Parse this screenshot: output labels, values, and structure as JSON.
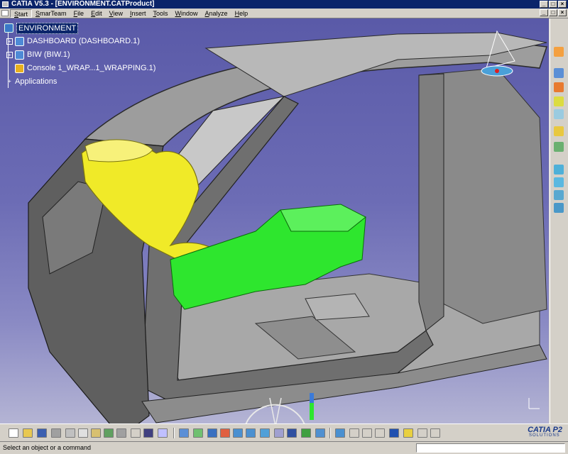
{
  "window": {
    "title": "CATIA V5.3 - [ENVIRONMENT.CATProduct]",
    "min_glyph": "_",
    "max_glyph": "□",
    "close_glyph": "×"
  },
  "menu": {
    "items": [
      "Start",
      "SmarTeam",
      "File",
      "Edit",
      "View",
      "Insert",
      "Tools",
      "Window",
      "Analyze",
      "Help"
    ]
  },
  "tree": {
    "root": "ENVIRONMENT",
    "children": [
      {
        "label": "DASHBOARD (DASHBOARD.1)",
        "icon": "product-icon"
      },
      {
        "label": "BIW (BIW.1)",
        "icon": "product-icon"
      },
      {
        "label": "Console 1_WRAP...1_WRAPPING.1)",
        "icon": "part-icon"
      }
    ],
    "applications": "Applications"
  },
  "status": {
    "message": "Select an object or a command",
    "command_input": ""
  },
  "brand": {
    "name": "CATIA P2",
    "subtitle": "SOLUTIONS"
  },
  "colors": {
    "title_bar": "#0a246a",
    "background_top": "#5a5aa8",
    "background_bottom": "#b4b4d4",
    "seat": "#f0ea28",
    "console": "#2ee62e",
    "body_in_white": "#9a9a9a"
  }
}
